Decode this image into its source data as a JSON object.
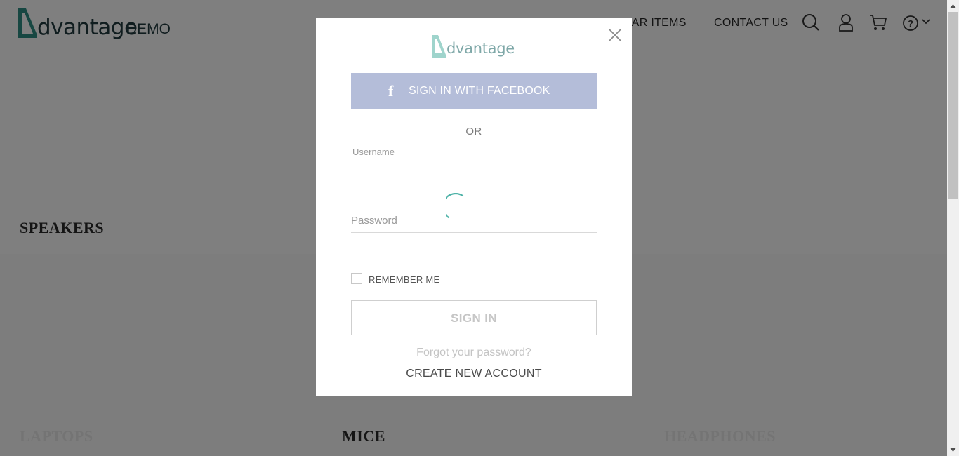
{
  "header": {
    "logo_word": "dvantage",
    "logo_suffix": "DEMO",
    "nav": {
      "popular_items": "POPULAR ITEMS",
      "popular_items_visible": "LAR ITEMS",
      "contact_us": "CONTACT US"
    },
    "icons": [
      "search-icon",
      "user-icon",
      "cart-icon",
      "help-icon",
      "chevron-down-icon"
    ]
  },
  "page": {
    "categories": {
      "speakers": "SPEAKERS",
      "laptops": "LAPTOPS",
      "mice": "MICE",
      "headphones": "HEADPHONES"
    }
  },
  "modal": {
    "logo_word": "dvantage",
    "facebook_label": "SIGN IN WITH FACEBOOK",
    "or_label": "OR",
    "username_label": "Username",
    "username_value": "",
    "password_label": "Password",
    "password_value": "",
    "remember_label": "REMEMBER ME",
    "remember_checked": false,
    "signin_label": "SIGN IN",
    "forgot_label": "Forgot your password?",
    "create_label": "CREATE NEW ACCOUNT"
  },
  "colors": {
    "brand_teal": "#4fb3a8",
    "facebook_blue": "#b4bdd9",
    "overlay": "rgba(0,0,0,0.5)"
  }
}
